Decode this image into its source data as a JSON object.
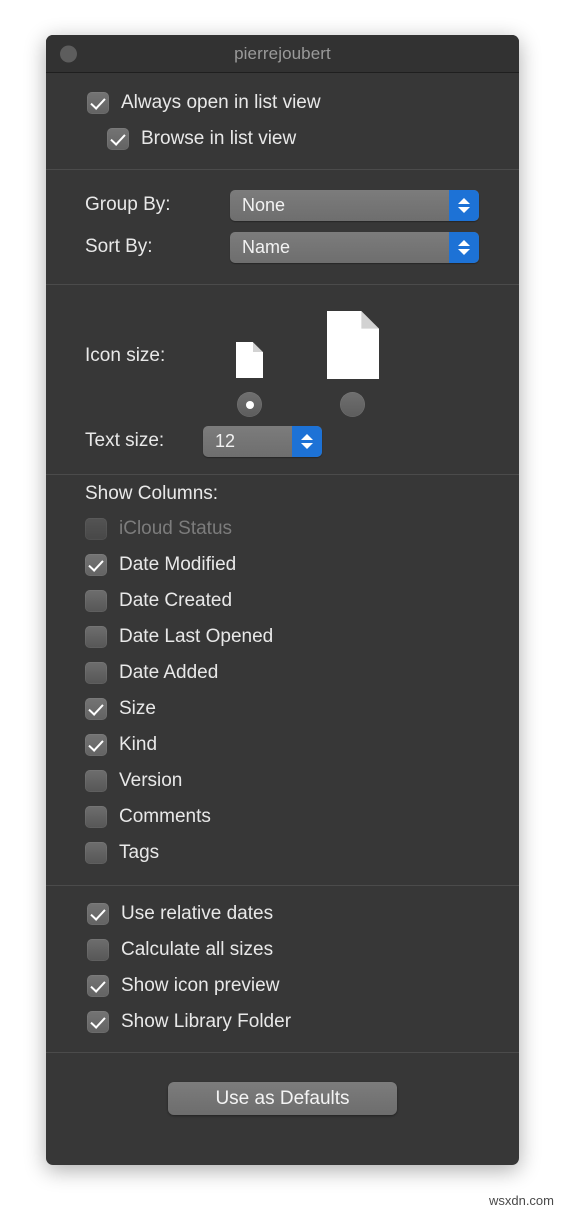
{
  "window": {
    "title": "pierrejoubert",
    "close_icon": "close-button"
  },
  "view_section": {
    "always_open": {
      "label": "Always open in list view",
      "checked": true
    },
    "browse_in_list": {
      "label": "Browse in list view",
      "checked": true
    }
  },
  "sort_section": {
    "group_by": {
      "label": "Group By:",
      "value": "None"
    },
    "sort_by": {
      "label": "Sort By:",
      "value": "Name"
    }
  },
  "icon_section": {
    "icon_size_label": "Icon size:",
    "small_selected": true,
    "large_selected": false,
    "text_size_label": "Text size:",
    "text_size_value": "12"
  },
  "columns_section": {
    "title": "Show Columns:",
    "items": [
      {
        "label": "iCloud Status",
        "checked": false,
        "disabled": true
      },
      {
        "label": "Date Modified",
        "checked": true,
        "disabled": false
      },
      {
        "label": "Date Created",
        "checked": false,
        "disabled": false
      },
      {
        "label": "Date Last Opened",
        "checked": false,
        "disabled": false
      },
      {
        "label": "Date Added",
        "checked": false,
        "disabled": false
      },
      {
        "label": "Size",
        "checked": true,
        "disabled": false
      },
      {
        "label": "Kind",
        "checked": true,
        "disabled": false
      },
      {
        "label": "Version",
        "checked": false,
        "disabled": false
      },
      {
        "label": "Comments",
        "checked": false,
        "disabled": false
      },
      {
        "label": "Tags",
        "checked": false,
        "disabled": false
      }
    ]
  },
  "options_section": {
    "items": [
      {
        "label": "Use relative dates",
        "checked": true
      },
      {
        "label": "Calculate all sizes",
        "checked": false
      },
      {
        "label": "Show icon preview",
        "checked": true
      },
      {
        "label": "Show Library Folder",
        "checked": true
      }
    ]
  },
  "footer": {
    "defaults_label": "Use as Defaults"
  },
  "watermark": {
    "text": "wsxdn.com"
  },
  "colors": {
    "window_bg": "#373737",
    "titlebar_bg": "#323232",
    "accent_blue": "#1d72d6",
    "control_gray": "#737373",
    "text": "#e8e8e8",
    "text_dim": "#7c7c7c"
  }
}
